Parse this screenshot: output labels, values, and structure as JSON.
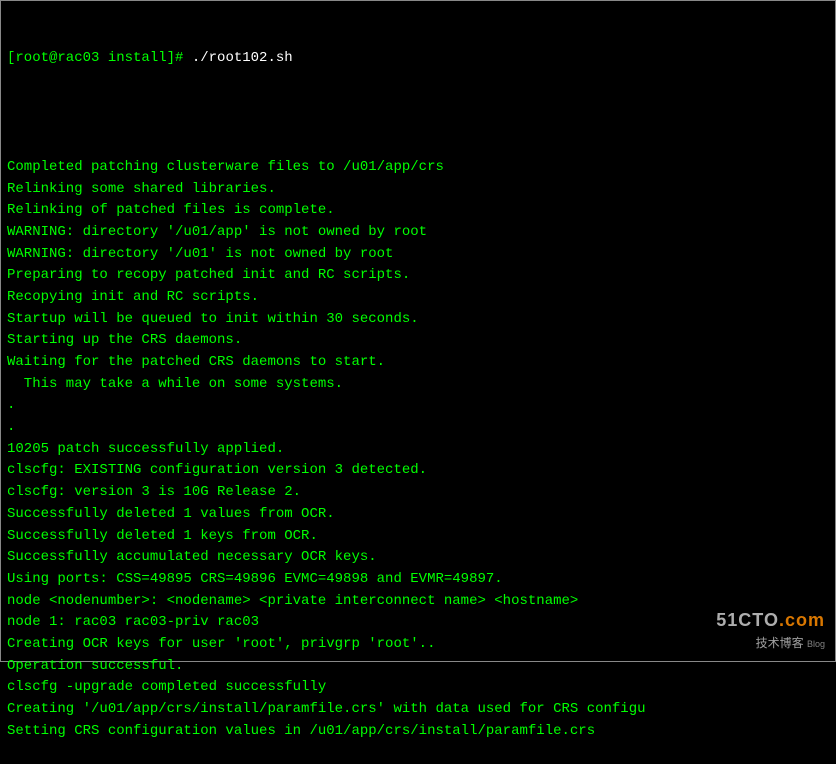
{
  "prompt": "[root@rac03 install]# ",
  "command": "./root102.sh",
  "lines": [
    "",
    "",
    "Completed patching clusterware files to /u01/app/crs",
    "Relinking some shared libraries.",
    "Relinking of patched files is complete.",
    "WARNING: directory '/u01/app' is not owned by root",
    "WARNING: directory '/u01' is not owned by root",
    "Preparing to recopy patched init and RC scripts.",
    "Recopying init and RC scripts.",
    "Startup will be queued to init within 30 seconds.",
    "Starting up the CRS daemons.",
    "Waiting for the patched CRS daemons to start.",
    "  This may take a while on some systems.",
    ".",
    ".",
    "10205 patch successfully applied.",
    "clscfg: EXISTING configuration version 3 detected.",
    "clscfg: version 3 is 10G Release 2.",
    "Successfully deleted 1 values from OCR.",
    "Successfully deleted 1 keys from OCR.",
    "Successfully accumulated necessary OCR keys.",
    "Using ports: CSS=49895 CRS=49896 EVMC=49898 and EVMR=49897.",
    "node <nodenumber>: <nodename> <private interconnect name> <hostname>",
    "node 1: rac03 rac03-priv rac03",
    "Creating OCR keys for user 'root', privgrp 'root'..",
    "Operation successful.",
    "clscfg -upgrade completed successfully",
    "Creating '/u01/app/crs/install/paramfile.crs' with data used for CRS configu",
    "Setting CRS configuration values in /u01/app/crs/install/paramfile.crs"
  ],
  "watermark": {
    "brand_a": "51CTO",
    "brand_b": ".com",
    "tagline": "技术博客",
    "blog": "Blog"
  }
}
